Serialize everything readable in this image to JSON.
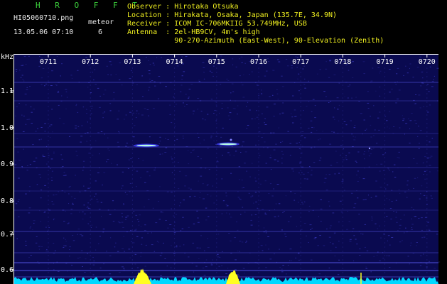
{
  "header": {
    "title": "H R O F F T",
    "filename": "HI05060710.png",
    "datetime": "13.05.06 07:10",
    "meteor_label": "meteor",
    "meteor_count": "6",
    "info_lines": [
      "Observer : Hirotaka Otsuka",
      "Location : Hirakata, Osaka, Japan (135.7E, 34.9N)",
      "Receiver : ICOM IC-706MKIIG 53.749MHz, USB",
      "Antenna  : 2el-HB9CV, 4m's high",
      "           90-270-Azimuth (East-West), 90-Elevation (Zenith)"
    ]
  },
  "axis": {
    "unit": "kHz",
    "y_ticks": [
      "1.1",
      "1.0",
      "0.9",
      "0.8",
      "0.7",
      "0.6"
    ],
    "x_ticks": [
      "0711",
      "0712",
      "0713",
      "0714",
      "0715",
      "0716",
      "0717",
      "0718",
      "0719",
      "0720"
    ]
  },
  "colors": {
    "background": "#0a0a50",
    "noise": "#3a3ac0",
    "echo": "#b8ffe0",
    "signal_peak": "#ffff20",
    "noise_floor": "#00d8ff",
    "tick": "#ffffff"
  }
}
